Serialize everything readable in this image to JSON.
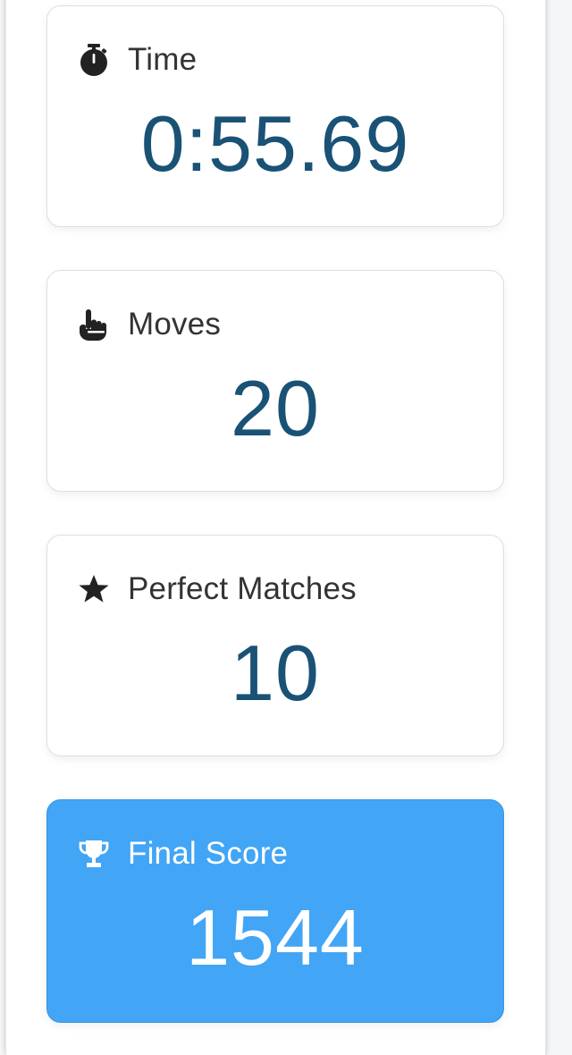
{
  "colors": {
    "value_text": "#1a5276",
    "label_text": "#333333",
    "highlight_card": "#42a5f5",
    "highlight_text": "#ffffff"
  },
  "stats": {
    "time": {
      "label": "Time",
      "value": "0:55.69",
      "icon": "stopwatch-icon"
    },
    "moves": {
      "label": "Moves",
      "value": "20",
      "icon": "pointer-hand-icon"
    },
    "perfect_matches": {
      "label": "Perfect Matches",
      "value": "10",
      "icon": "star-icon"
    },
    "final_score": {
      "label": "Final Score",
      "value": "1544",
      "icon": "trophy-icon"
    }
  }
}
